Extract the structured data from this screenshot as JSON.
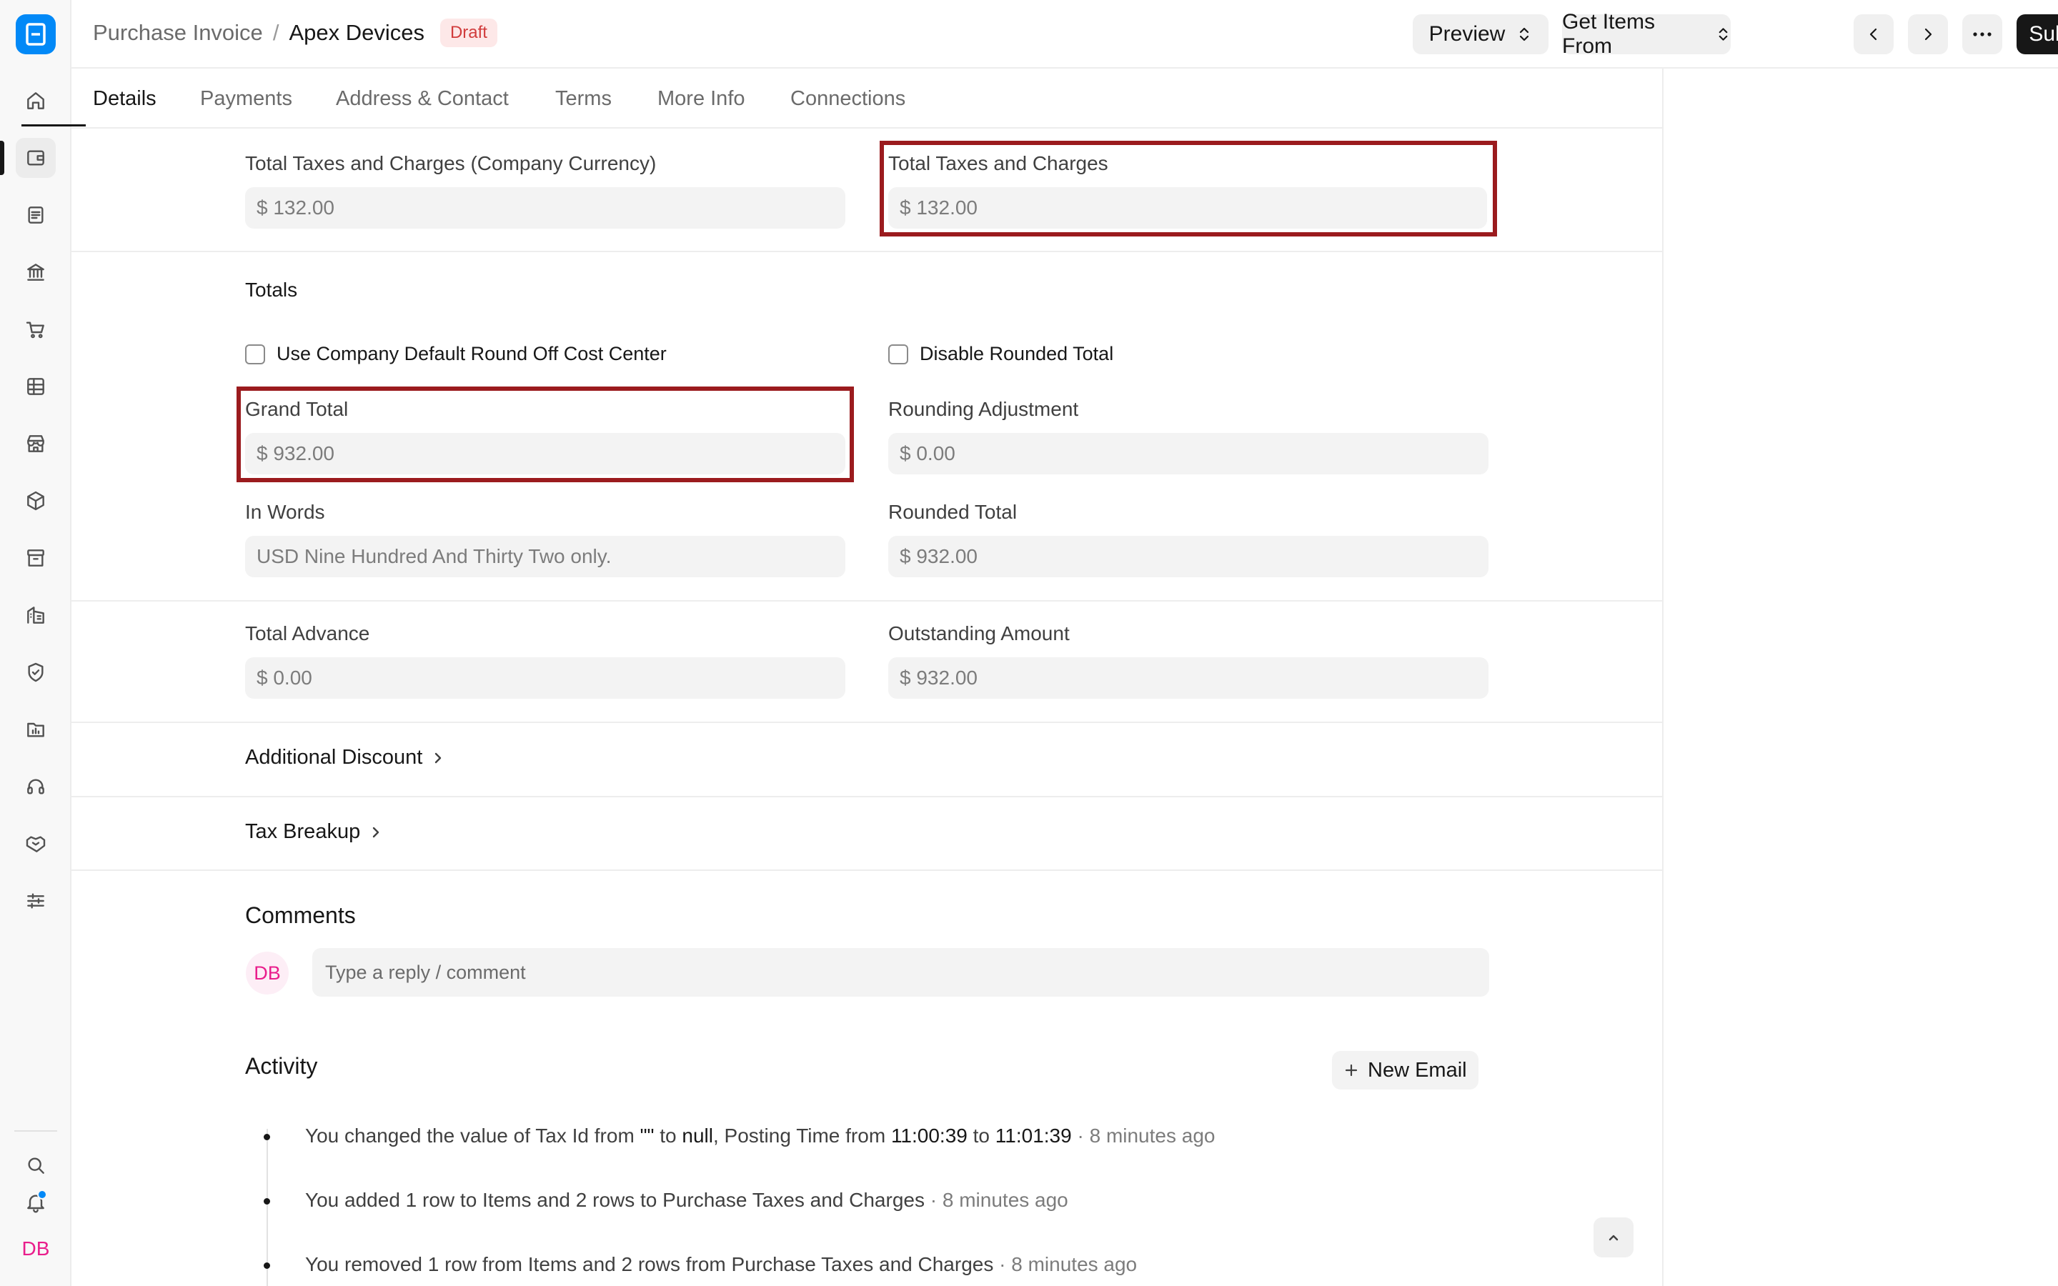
{
  "header": {
    "parent": "Purchase Invoice",
    "separator": "/",
    "title": "Apex Devices",
    "status": "Draft",
    "preview_label": "Preview",
    "get_items_label": "Get Items From",
    "submit_label": "Submit"
  },
  "tabs": [
    "Details",
    "Payments",
    "Address & Contact",
    "Terms",
    "More Info",
    "Connections"
  ],
  "taxes": {
    "company_currency_label": "Total Taxes and Charges (Company Currency)",
    "company_currency_value": "$ 132.00",
    "total_label": "Total Taxes and Charges",
    "total_value": "$ 132.00"
  },
  "totals": {
    "section_title": "Totals",
    "round_off_label": "Use Company Default Round Off Cost Center",
    "disable_rounded_label": "Disable Rounded Total",
    "grand_total_label": "Grand Total",
    "grand_total_value": "$ 932.00",
    "rounding_adjustment_label": "Rounding Adjustment",
    "rounding_adjustment_value": "$ 0.00",
    "in_words_label": "In Words",
    "in_words_value": "USD Nine Hundred And Thirty Two only.",
    "rounded_total_label": "Rounded Total",
    "rounded_total_value": "$ 932.00"
  },
  "advance": {
    "total_advance_label": "Total Advance",
    "total_advance_value": "$ 0.00",
    "outstanding_label": "Outstanding Amount",
    "outstanding_value": "$ 932.00"
  },
  "collapsibles": {
    "additional_discount": "Additional Discount",
    "tax_breakup": "Tax Breakup"
  },
  "comments": {
    "title": "Comments",
    "avatar_initials": "DB",
    "placeholder": "Type a reply / comment"
  },
  "activity": {
    "title": "Activity",
    "new_email_label": "New Email",
    "items": [
      {
        "p1": "You changed the value of Tax Id from ",
        "s1": "\"\"",
        "p2": " to ",
        "s2": "null",
        "p3": ", Posting Time from ",
        "s3": "11:00:39",
        "p4": " to ",
        "s4": "11:01:39",
        "time": " · 8 minutes ago"
      },
      {
        "text": "You added 1 row to Items and 2 rows to Purchase Taxes and Charges",
        "time": " · 8 minutes ago"
      },
      {
        "text": "You removed 1 row from Items and 2 rows from Purchase Taxes and Charges",
        "time": " · 8 minutes ago"
      }
    ]
  },
  "sidebar": {
    "user_initials": "DB",
    "icons": [
      "home-icon",
      "wallet-icon",
      "document-icon",
      "bank-icon",
      "cart-icon",
      "table-icon",
      "store-icon",
      "package-icon",
      "archive-icon",
      "building-icon",
      "shield-icon",
      "folder-chart-icon",
      "headset-icon",
      "handshake-icon",
      "settings-sliders-icon",
      "search-icon",
      "bell-icon"
    ]
  },
  "colors": {
    "brand": "#0289f7",
    "highlight": "#9b1b1e",
    "draft_badge": "#d13c3c",
    "avatar": "#e91e8c"
  }
}
